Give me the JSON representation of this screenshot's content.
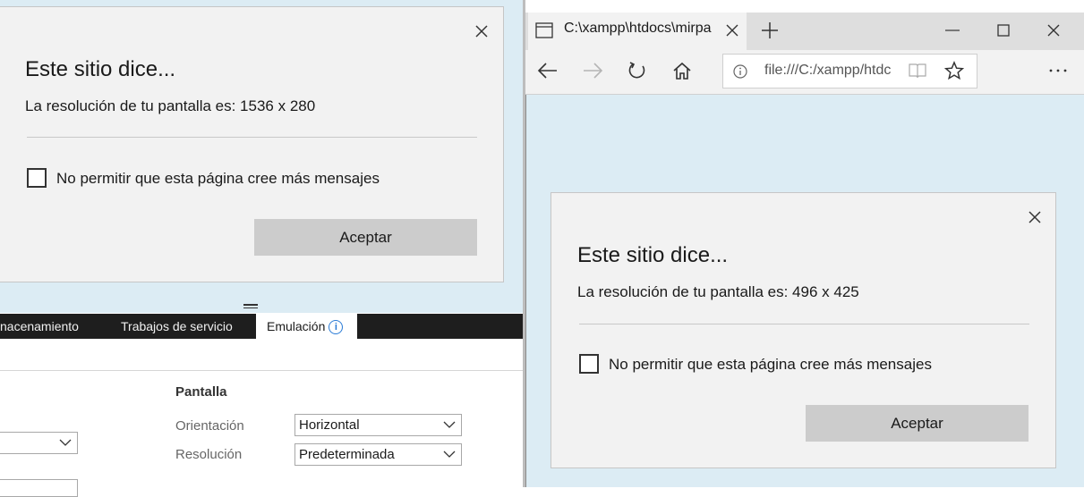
{
  "left_dialog": {
    "title": "Este sitio dice...",
    "message": "La resolución de tu pantalla es: 1536 x 280",
    "checkbox_label": "No permitir que esta página cree más mensajes",
    "ok_label": "Aceptar"
  },
  "devtools": {
    "tabs": [
      {
        "label": "nacenamiento"
      },
      {
        "label": "Trabajos de servicio"
      },
      {
        "label": "Emulación"
      }
    ],
    "info_icon": "i",
    "section_title": "Pantalla",
    "orientation_label": "Orientación",
    "orientation_value": "Horizontal",
    "resolution_label": "Resolución",
    "resolution_value": "Predeterminada"
  },
  "browser": {
    "tab_title": "C:\\xampp\\htdocs\\mirpa",
    "address": "file:///C:/xampp/htdc"
  },
  "right_dialog": {
    "title": "Este sitio dice...",
    "message": "La resolución de tu pantalla es: 496 x 425",
    "checkbox_label": "No permitir que esta página cree más mensajes",
    "ok_label": "Aceptar"
  },
  "icons": [
    "close-icon",
    "tab-page-icon",
    "new-tab-icon",
    "minimize-icon",
    "maximize-icon",
    "back-icon",
    "forward-icon",
    "refresh-icon",
    "home-icon",
    "info-icon",
    "reading-view-icon",
    "favorite-star-icon",
    "more-icon",
    "chevron-down-icon"
  ],
  "colors": {
    "page_bg": "#dcecf4",
    "dialog_bg": "#f2f2f2",
    "button_bg": "#cccccc",
    "devtools_tabbar": "#1e1e1e",
    "info_blue": "#2a7bd6"
  }
}
